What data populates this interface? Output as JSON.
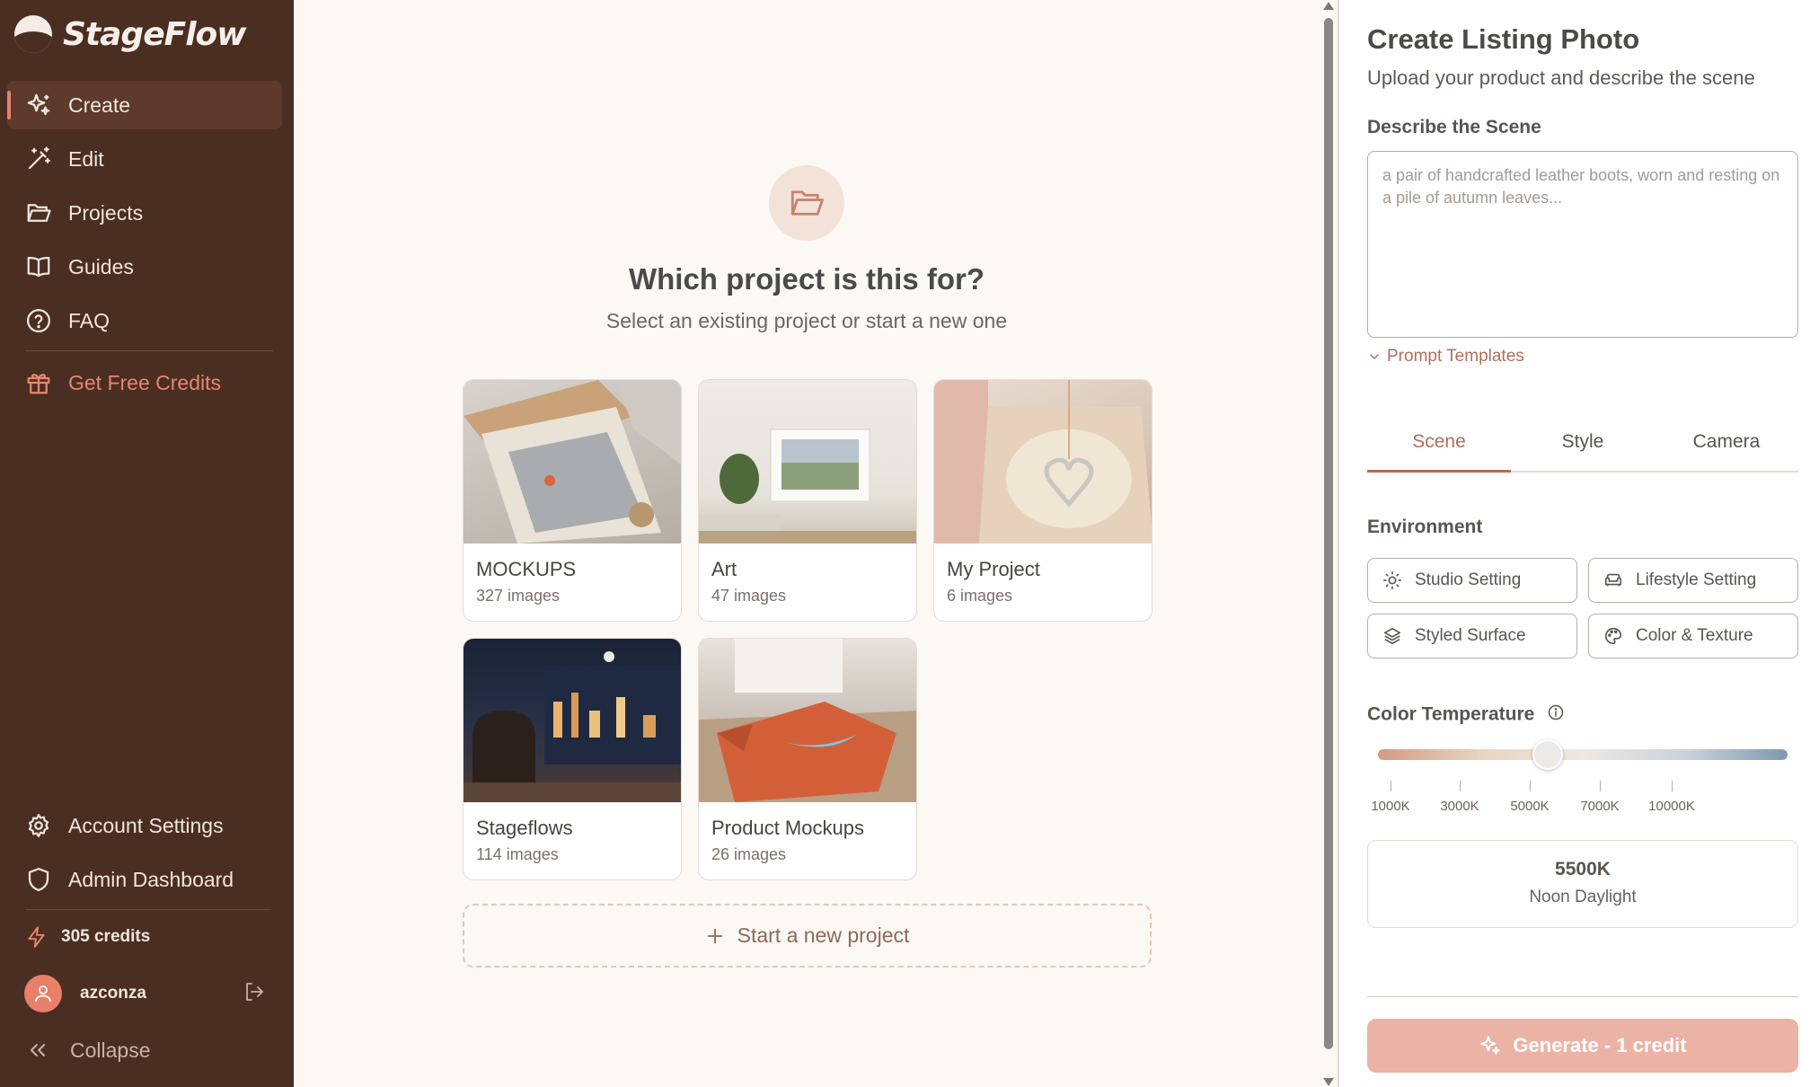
{
  "app": {
    "name": "StageFlow"
  },
  "sidebar": {
    "items": [
      {
        "label": "Create",
        "icon": "sparkles-icon",
        "active": true
      },
      {
        "label": "Edit",
        "icon": "magic-wand-icon"
      },
      {
        "label": "Projects",
        "icon": "folder-open-icon"
      },
      {
        "label": "Guides",
        "icon": "book-icon"
      },
      {
        "label": "FAQ",
        "icon": "help-circle-icon"
      }
    ],
    "promo": {
      "label": "Get Free Credits",
      "icon": "gift-icon"
    },
    "bottom_items": [
      {
        "label": "Account Settings",
        "icon": "gear-icon"
      },
      {
        "label": "Admin Dashboard",
        "icon": "shield-icon"
      }
    ],
    "credits": "305 credits",
    "user": {
      "name": "azconza"
    },
    "collapse_label": "Collapse"
  },
  "main": {
    "title": "Which project is this for?",
    "subtitle": "Select an existing project or start a new one",
    "projects": [
      {
        "name": "MOCKUPS",
        "count": "327 images"
      },
      {
        "name": "Art",
        "count": "47 images"
      },
      {
        "name": "My Project",
        "count": "6 images"
      },
      {
        "name": "Stageflows",
        "count": "114 images"
      },
      {
        "name": "Product Mockups",
        "count": "26 images"
      }
    ],
    "new_project_label": "Start a new project"
  },
  "panel": {
    "title": "Create Listing Photo",
    "subtitle": "Upload your product and describe the scene",
    "scene_label": "Describe the Scene",
    "scene_placeholder": "a pair of handcrafted leather boots, worn and resting on a pile of autumn leaves...",
    "scene_value": "",
    "templates_label": "Prompt Templates",
    "tabs": [
      {
        "label": "Scene",
        "active": true
      },
      {
        "label": "Style"
      },
      {
        "label": "Camera"
      }
    ],
    "environment_label": "Environment",
    "environment_options": [
      {
        "label": "Studio Setting",
        "icon": "sun-icon"
      },
      {
        "label": "Lifestyle Setting",
        "icon": "sofa-icon"
      },
      {
        "label": "Styled Surface",
        "icon": "layers-icon"
      },
      {
        "label": "Color & Texture",
        "icon": "palette-icon"
      }
    ],
    "color_temp": {
      "label": "Color Temperature",
      "ticks": [
        "1000K",
        "3000K",
        "5000K",
        "7000K",
        "10000K"
      ],
      "min": 1000,
      "max": 10000,
      "value": 5500,
      "value_label": "5500K",
      "preset_name": "Noon Daylight"
    },
    "generate_label": "Generate - 1 credit"
  },
  "colors": {
    "sidebar_bg": "#4a2e22",
    "accent": "#e8806a",
    "accent_text": "#b06e5c",
    "page_bg": "#fcf8f3",
    "generate_bg": "#eab3a5"
  }
}
